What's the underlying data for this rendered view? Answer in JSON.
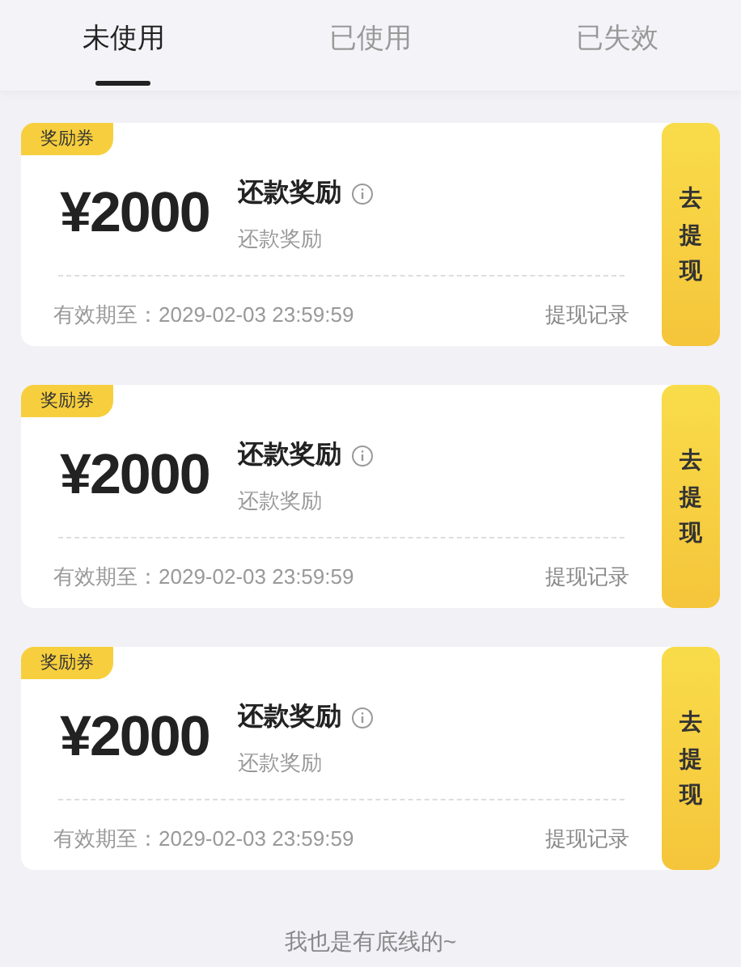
{
  "tabs": [
    {
      "label": "未使用",
      "selected": true
    },
    {
      "label": "已使用",
      "selected": false
    },
    {
      "label": "已失效",
      "selected": false
    }
  ],
  "coupons": [
    {
      "badge": "奖励券",
      "amount": "¥2000",
      "title": "还款奖励",
      "subtitle": "还款奖励",
      "expiry": "有效期至：2029-02-03 23:59:59",
      "record_link": "提现记录",
      "action": "去提现"
    },
    {
      "badge": "奖励券",
      "amount": "¥2000",
      "title": "还款奖励",
      "subtitle": "还款奖励",
      "expiry": "有效期至：2029-02-03 23:59:59",
      "record_link": "提现记录",
      "action": "去提现"
    },
    {
      "badge": "奖励券",
      "amount": "¥2000",
      "title": "还款奖励",
      "subtitle": "还款奖励",
      "expiry": "有效期至：2029-02-03 23:59:59",
      "record_link": "提现记录",
      "action": "去提现"
    }
  ],
  "footer": "我也是有底线的~"
}
